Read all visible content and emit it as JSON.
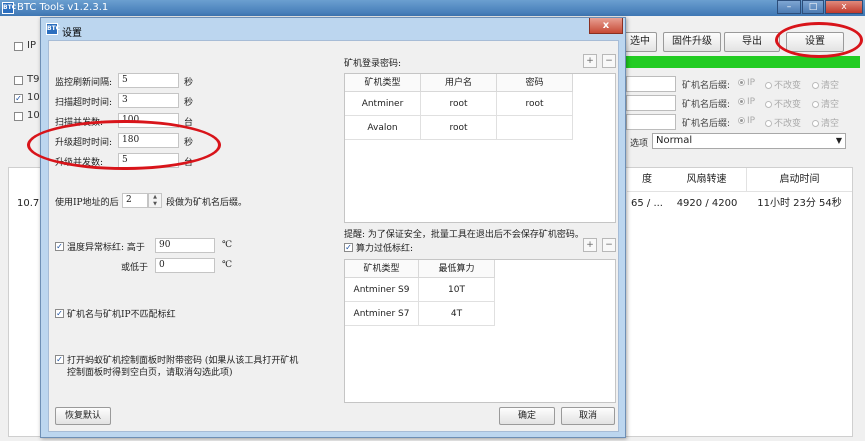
{
  "main": {
    "title": "BTC Tools v1.2.3.1",
    "logo_text": "BTC",
    "window_controls": [
      "–",
      "□",
      "x"
    ],
    "left_checkbox_label": "IP",
    "toolbar_buttons": {
      "select": "选中",
      "firmware": "固件升级",
      "export": "导出",
      "settings": "设置"
    },
    "rows": [
      {
        "label": "T9",
        "checked": false
      },
      {
        "label": "10.",
        "checked": true
      },
      {
        "label": "10.",
        "checked": false
      }
    ],
    "suffix_label": "矿机名后缀:",
    "suffix_options": [
      "IP",
      "不改变",
      "清空"
    ],
    "option_label": "选项",
    "option_value": "Normal",
    "list_headers": [
      "度",
      "风扇转速",
      "启动时间"
    ],
    "list_row": {
      "ip": "10.77",
      "temp": "65 / ...",
      "fan": "4920 / 4200",
      "uptime": "11小时 23分 54秒"
    }
  },
  "dialog": {
    "title": "设置",
    "logo_text": "BTC",
    "close_label": "x",
    "monitor_interval": {
      "label": "监控刷新间隔:",
      "value": "5",
      "unit": "秒"
    },
    "scan_timeout": {
      "label": "扫描超时时间:",
      "value": "3",
      "unit": "秒"
    },
    "scan_concurrency": {
      "label": "扫描并发数:",
      "value": "100",
      "unit": "台"
    },
    "upgrade_timeout": {
      "label": "升级超时时间:",
      "value": "180",
      "unit": "秒"
    },
    "upgrade_concurrency": {
      "label": "升级并发数:",
      "value": "5",
      "unit": "台"
    },
    "ip_suffix": {
      "prefix": "使用IP地址的后",
      "value": "2",
      "suffix": "段做为矿机名后缀。"
    },
    "temp_alert": {
      "label": "温度异常标红: 高于",
      "high_value": "90",
      "low_label": "或低于",
      "low_value": "0",
      "unit": "℃",
      "checked": true
    },
    "name_mismatch": {
      "label": "矿机名与矿机IP不匹配标红",
      "checked": true
    },
    "password_option": {
      "line1": "打开蚂蚁矿机控制面板时附带密码 (如果从该工具打开矿机",
      "line2": "控制面板时得到空白页，请取消勾选此项)",
      "checked": true
    },
    "restore_button": "恢复默认",
    "login_password_label": "矿机登录密码:",
    "login_table": {
      "headers": [
        "矿机类型",
        "用户名",
        "密码"
      ],
      "rows": [
        [
          "Antminer",
          "root",
          "root"
        ],
        [
          "Avalon",
          "root",
          ""
        ]
      ]
    },
    "notice": "提醒: 为了保证安全，批量工具在退出后不会保存矿机密码。",
    "hashrate_alert": {
      "label": "算力过低标红:",
      "checked": true
    },
    "hashrate_table": {
      "headers": [
        "矿机类型",
        "最低算力"
      ],
      "rows": [
        [
          "Antminer S9",
          "10T"
        ],
        [
          "Antminer S7",
          "4T"
        ]
      ]
    },
    "plus_label": "+",
    "minus_label": "−",
    "ok_button": "确定",
    "cancel_button": "取消"
  },
  "colors": {
    "accent_red": "#d8141a",
    "progress_green": "#22cc22",
    "title_blue": "#3f77b4"
  }
}
